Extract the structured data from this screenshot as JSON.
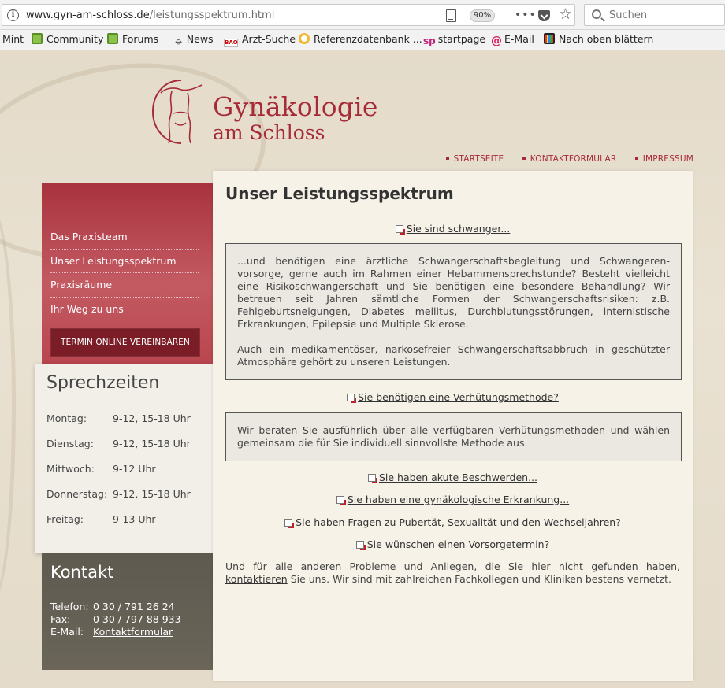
{
  "browser": {
    "url_domain": "www.gyn-am-schloss.de",
    "url_path": "/leistungsspektrum.html",
    "zoom": "90%",
    "search_placeholder": "Suchen"
  },
  "bookmarks": [
    {
      "label": "Mint"
    },
    {
      "label": "Community"
    },
    {
      "label": "Forums"
    },
    {
      "label": "News"
    },
    {
      "label": "Arzt-Suche"
    },
    {
      "label": "Referenzdatenbank ..."
    },
    {
      "label": "startpage",
      "icon_text": "sp"
    },
    {
      "label": "E-Mail",
      "icon_text": "@"
    },
    {
      "label": "Nach oben blättern"
    }
  ],
  "bao_icon_text": "BAO",
  "logo": {
    "line1": "Gynäkologie",
    "line2": "am Schloss",
    "color": "#a72b37"
  },
  "topnav": [
    "STARTSEITE",
    "KONTAKTFORMULAR",
    "IMPRESSUM"
  ],
  "sidenav": [
    "Das Praxisteam",
    "Unser Leistungsspektrum",
    "Praxisräume",
    "Ihr Weg zu uns"
  ],
  "termin_button": "TERMIN ONLINE VEREINBAREN",
  "sprechzeiten": {
    "title": "Sprechzeiten",
    "rows": [
      {
        "day": "Montag:",
        "time": "9-12, 15-18 Uhr"
      },
      {
        "day": "Dienstag:",
        "time": "9-12, 15-18 Uhr"
      },
      {
        "day": "Mittwoch:",
        "time": "9-12 Uhr"
      },
      {
        "day": "Donnerstag:",
        "time": "9-12, 15-18 Uhr"
      },
      {
        "day": "Freitag:",
        "time": "9-13 Uhr"
      }
    ]
  },
  "kontakt": {
    "title": "Kontakt",
    "telefon_label": "Telefon:",
    "telefon": "0 30 / 791 26 24",
    "fax_label": "Fax:",
    "fax": "0 30 / 797 88 933",
    "email_label": "E-Mail:",
    "email_link": "Kontaktformular"
  },
  "main": {
    "title": "Unser Leistungsspektrum",
    "link_schwanger": "Sie sind schwanger...",
    "box1_p1": "...und benötigen eine ärztliche Schwangerschaftsbegleitung und Schwangeren-vorsorge, gerne auch im Rahmen einer Hebammensprechstunde? Besteht vielleicht eine Risikoschwangerschaft und Sie benötigen eine besondere Behandlung? Wir betreuen seit Jahren sämtliche Formen der Schwangerschaftsrisiken: z.B. Fehlgeburtsneigungen, Diabetes mellitus, Durchblutungsstörungen, internistische Erkrankungen, Epilepsie und Multiple Sklerose.",
    "box1_p2": "Auch ein medikamentöser, narkosefreier Schwangerschaftsabbruch in geschützter Atmosphäre gehört zu unseren Leistungen.",
    "link_verhuetung": "Sie benötigen eine Verhütungsmethode?",
    "box2_p1": "Wir beraten Sie ausführlich über alle verfügbaren Verhütungsmethoden und wählen gemeinsam die für Sie individuell sinnvollste Methode aus.",
    "link_beschwerden": "Sie haben akute Beschwerden...",
    "link_erkrankung": "Sie haben eine gynäkologische Erkrankung...",
    "link_pubertaet": "Sie haben Fragen zu Pubertät, Sexualität und den Wechseljahren?",
    "link_vorsorge": "Sie wünschen einen Vorsorgetermin?",
    "closing_before": "Und für alle anderen Probleme und Anliegen, die Sie hier nicht gefunden haben, ",
    "closing_link": "kontaktieren",
    "closing_after": " Sie uns. Wir sind mit zahlreichen Fachkollegen und Kliniken bestens vernetzt."
  }
}
